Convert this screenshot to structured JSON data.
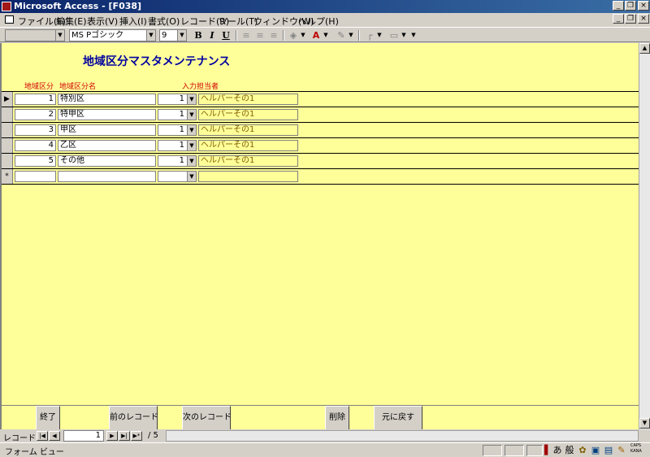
{
  "window": {
    "title": "Microsoft Access - [F038]"
  },
  "window_controls": [
    "_",
    "❐",
    "×"
  ],
  "menu": [
    "ファイル(F)",
    "編集(E)",
    "表示(V)",
    "挿入(I)",
    "書式(O)",
    "レコード(R)",
    "ツール(T)",
    "ウィンドウ(W)",
    "ヘルプ(H)"
  ],
  "toolbar": {
    "object_value": "",
    "font": "MS Pゴシック",
    "size": "9",
    "bold": "B",
    "italic": "I",
    "underline": "U"
  },
  "form": {
    "title": "地域区分マスタメンテナンス",
    "headers": {
      "code": "地域区分",
      "name": "地域区分名",
      "staff": "入力担当者"
    },
    "rows": [
      {
        "code": "1",
        "name": "特別区",
        "staff_no": "1",
        "staff_name": "ヘルパーその1"
      },
      {
        "code": "2",
        "name": "特甲区",
        "staff_no": "1",
        "staff_name": "ヘルパーその1"
      },
      {
        "code": "3",
        "name": "甲区",
        "staff_no": "1",
        "staff_name": "ヘルパーその1"
      },
      {
        "code": "4",
        "name": "乙区",
        "staff_no": "1",
        "staff_name": "ヘルパーその1"
      },
      {
        "code": "5",
        "name": "その他",
        "staff_no": "1",
        "staff_name": "ヘルパーその1"
      }
    ],
    "new_row_marker": "*",
    "current_marker": "▶"
  },
  "footer_buttons": {
    "exit": "終了",
    "prev": "前のレコード",
    "next": "次のレコード",
    "delete": "削除",
    "undo": "元に戻す"
  },
  "navigation": {
    "label": "レコード:",
    "current": "1",
    "total": "/ 5"
  },
  "status": {
    "text": "フォーム ビュー"
  },
  "ime": {
    "mode": "あ",
    "kanji": "般",
    "caps": "CAPS",
    "kana": "KANA"
  }
}
